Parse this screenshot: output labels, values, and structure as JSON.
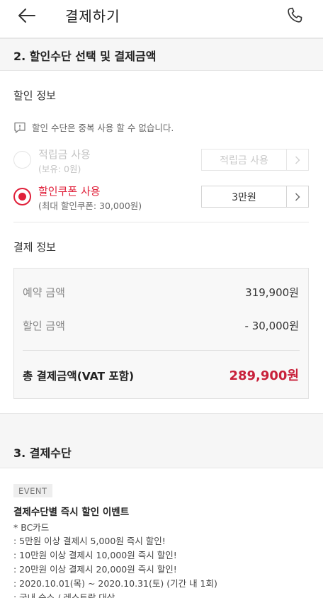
{
  "header": {
    "title": "결제하기",
    "back_icon": "arrow-left-icon",
    "phone_icon": "phone-icon"
  },
  "section2": {
    "title": "2. 할인수단 선택 및 결제금액"
  },
  "discount": {
    "title": "할인 정보",
    "notice": "할인 수단은 중복 사용 할 수 없습니다.",
    "options": [
      {
        "label": "적립금 사용",
        "sub": "(보유: 0원)",
        "value": "적립금 사용",
        "selected": false,
        "disabled": true
      },
      {
        "label": "할인쿠폰 사용",
        "sub": "(최대 할인쿠폰: 30,000원)",
        "value": "3만원",
        "selected": true,
        "disabled": false
      }
    ]
  },
  "payment_info": {
    "title": "결제 정보",
    "rows": [
      {
        "label": "예약 금액",
        "value": "319,900원"
      },
      {
        "label": "할인 금액",
        "value": "- 30,000원"
      }
    ],
    "total_label": "총 결제금액(VAT 포함)",
    "total_value": "289,900원"
  },
  "section3": {
    "title": "3. 결제수단"
  },
  "event": {
    "badge": "EVENT",
    "title": "결제수단별 즉시 할인 이벤트",
    "lines": [
      "* BC카드",
      ": 5만원 이상 결제시 5,000원 즉시 할인!",
      ": 10만원 이상 결제시 10,000원 즉시 할인!",
      ": 20만원 이상 결제시 20,000원 즉시 할인!",
      ": 2020.10.01(목) ~ 2020.10.31(토) (기간 내 1회)",
      ": 국내 숙소 / 레스토랑 대상"
    ]
  },
  "colors": {
    "accent": "#e0203a",
    "total": "#c8203a"
  }
}
